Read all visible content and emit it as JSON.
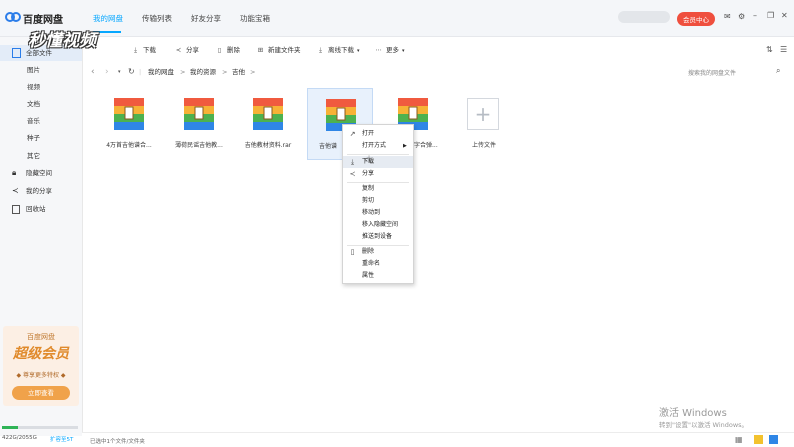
{
  "app": {
    "title": "百度网盘"
  },
  "nav": {
    "tabs": [
      "我的网盘",
      "传输列表",
      "好友分享",
      "功能宝箱"
    ]
  },
  "header": {
    "vip_label": "会员中心"
  },
  "sidebar": {
    "items": [
      {
        "label": "全部文件"
      },
      {
        "label": "图片"
      },
      {
        "label": "视频"
      },
      {
        "label": "文档"
      },
      {
        "label": "音乐"
      },
      {
        "label": "种子"
      },
      {
        "label": "其它"
      },
      {
        "label": "隐藏空间"
      },
      {
        "label": "我的分享"
      },
      {
        "label": "回收站"
      }
    ],
    "promo": {
      "brand": "百度网盘",
      "title": "超级会员",
      "subtitle": "◆ 尊享更多特权 ◆",
      "button": "立即查看"
    },
    "storage": {
      "text": "422G/2055G",
      "fraction": 0.205,
      "expand": "扩容至5T"
    }
  },
  "toolbar": {
    "download": "下载",
    "share": "分享",
    "delete": "删除",
    "new_folder": "新建文件夹",
    "offline": "离线下载",
    "more": "更多"
  },
  "breadcrumb": {
    "items": [
      "我的网盘",
      "我的资源",
      "吉他"
    ],
    "search_placeholder": "搜索我的网盘文件"
  },
  "files": [
    {
      "name": "4万首吉他谱合..."
    },
    {
      "name": "薄荷民谣吉他教..."
    },
    {
      "name": "吉他教材资料.rar"
    },
    {
      "name": "吉他谱"
    },
    {
      "name": "吉他字合弹..."
    },
    {
      "name": "上传文件"
    }
  ],
  "context_menu": {
    "open": "打开",
    "open_with": "打开方式",
    "download": "下载",
    "share": "分享",
    "copy": "复制",
    "cut": "剪切",
    "move_to": "移动到",
    "move_hidden": "移入隐藏空间",
    "push_device": "推送到设备",
    "delete": "删除",
    "rename": "重命名",
    "properties": "属性"
  },
  "status": {
    "selection": "已选中1个文件/文件夹"
  },
  "watermark": {
    "title": "激活 Windows",
    "line": "转到\"设置\"以激活 Windows。",
    "overlay": "秒懂视频"
  },
  "colors": {
    "accent": "#06a7ff",
    "vip": "#ef4f3e"
  }
}
